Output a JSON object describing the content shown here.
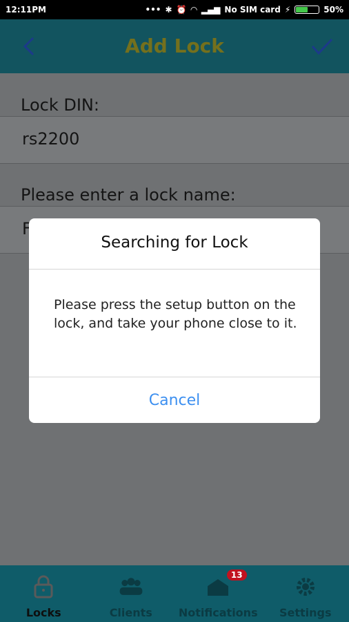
{
  "status_bar": {
    "time": "12:11PM",
    "carrier": "No SIM card",
    "battery": "50%",
    "battery_level": 0.5
  },
  "header": {
    "title": "Add Lock",
    "icons": [
      "back-icon",
      "check-icon"
    ]
  },
  "form": {
    "din_label": "Lock DIN:",
    "din_value": "rs2200",
    "name_label": "Please enter a lock name:",
    "name_value_partial": "F"
  },
  "dialog": {
    "title": "Searching for Lock",
    "message": "Please press the setup button on the lock, and take your phone close to it.",
    "cancel_label": "Cancel"
  },
  "bottom_nav": {
    "items": [
      {
        "label": "Locks",
        "icon": "lock-icon",
        "active": true
      },
      {
        "label": "Clients",
        "icon": "clients-icon"
      },
      {
        "label": "Notifications",
        "icon": "notifications-icon",
        "badge": "13"
      },
      {
        "label": "Settings",
        "icon": "gear-icon"
      }
    ]
  },
  "colors": {
    "header_bg": "#12545f",
    "title_text": "#74701d",
    "overlay_bg": "#6f7173",
    "accent_link": "#3c8ff0",
    "badge": "#c1121f"
  }
}
